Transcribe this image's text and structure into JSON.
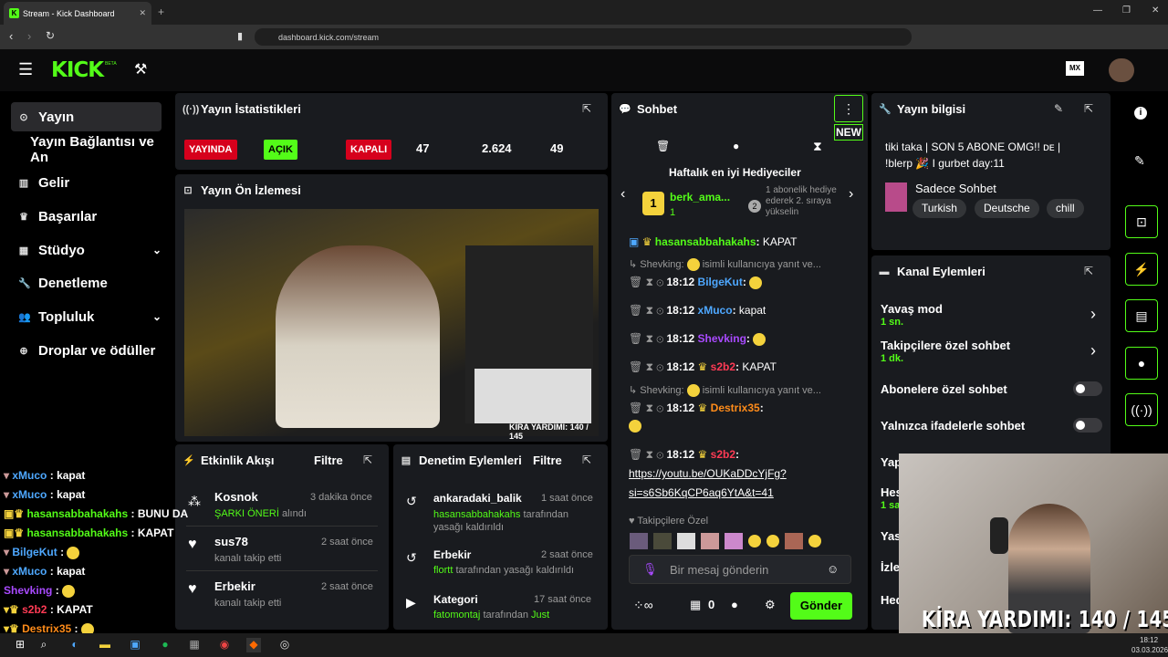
{
  "browser": {
    "tab_title": "Stream - Kick Dashboard",
    "url": "dashboard.kick.com/stream"
  },
  "brand": {
    "logo": "KICK",
    "beta": "BETA"
  },
  "sidebar": {
    "items": [
      {
        "label": "Yayın",
        "icon": "broadcast-icon"
      },
      {
        "label": "Yayın Bağlantısı ve An",
        "icon": ""
      },
      {
        "label": "Gelir",
        "icon": "chart-icon"
      },
      {
        "label": "Başarılar",
        "icon": "trophy-icon"
      },
      {
        "label": "Stüdyo",
        "icon": "studio-icon"
      },
      {
        "label": "Denetleme",
        "icon": "wrench-icon"
      },
      {
        "label": "Topluluk",
        "icon": "people-icon"
      },
      {
        "label": "Droplar ve ödüller",
        "icon": "gift-icon"
      }
    ]
  },
  "stats": {
    "title": "Yayın İstatistikleri",
    "live": "YAYINDA",
    "open": "AÇIK",
    "closed": "KAPALI",
    "v1": "47",
    "v2": "2.624",
    "v3": "49"
  },
  "preview": {
    "title": "Yayın Ön İzlemesi",
    "caption": "KİRA YARDIMI: 140 / 145"
  },
  "activity": {
    "title": "Etkinlik Akışı",
    "filter": "Filtre",
    "items": [
      {
        "name": "Kosnok",
        "time": "3 dakika önce",
        "desc1": "ŞARKI ÖNERİ",
        "desc2": " alındı"
      },
      {
        "name": "sus78",
        "time": "2 saat önce",
        "desc": "kanalı takip etti"
      },
      {
        "name": "Erbekir",
        "time": "2 saat önce",
        "desc": "kanalı takip etti"
      }
    ]
  },
  "moderation": {
    "title": "Denetim Eylemleri",
    "filter": "Filtre",
    "items": [
      {
        "name": "ankaradaki_balik",
        "time": "1 saat önce",
        "by": "hasansabbahakahs",
        "desc": "tarafından yasağı kaldırıldı"
      },
      {
        "name": "Erbekir",
        "time": "2 saat önce",
        "by": "flortt",
        "desc": "tarafından yasağı kaldırıldı"
      },
      {
        "name": "Kategori",
        "time": "17 saat önce",
        "by": "fatomontaj",
        "desc": "tarafından",
        "extra": "Just"
      }
    ]
  },
  "chat": {
    "title": "Sohbet",
    "new": "NEW",
    "top_title": "Haftalık en iyi Hediyeciler",
    "top_user": "berk_ama...",
    "top_count": "1",
    "rank2": "1 abonelik hediye ederek 2. sıraya yükselin",
    "messages": [
      {
        "time": "",
        "user": "hasansabbahakahs",
        "text": "KAPAT",
        "color": "#53fc18"
      },
      {
        "reply": "Shevking:",
        "replytext": "isimli kullanıcıya yanıt ve..."
      },
      {
        "time": "18:12",
        "user": "BilgeKut",
        "text": "",
        "color": "#4ea8ff"
      },
      {
        "time": "18:12",
        "user": "xMuco",
        "text": "kapat",
        "color": "#4ea8ff"
      },
      {
        "time": "18:12",
        "user": "Shevking",
        "text": "",
        "color": "#a94aff"
      },
      {
        "time": "18:12",
        "user": "s2b2",
        "text": "KAPAT",
        "color": "#ff3b55"
      },
      {
        "reply": "Shevking:",
        "replytext": "isimli kullanıcıya yanıt ve..."
      },
      {
        "time": "18:12",
        "user": "Destrix35",
        "text": "",
        "color": "#ff8c1a"
      },
      {
        "time": "18:12",
        "user": "s2b2",
        "text": "",
        "color": "#ff3b55"
      }
    ],
    "link1": "https://youtu.be/OUKaDDcYjFg?",
    "link2": "si=s6Sb6KqCP6aq6YtA&t=41",
    "followers_only": "Takipçilere Özel",
    "placeholder": "Bir mesaj gönderin",
    "count": "0",
    "send": "Gönder"
  },
  "info": {
    "title": "Yayın bilgisi",
    "stream_title": "tiki taka | SON 5 ABONE OMG!! ᴅᴇ | !blerp 🎉 I gurbet day:11",
    "category": "Sadece Sohbet",
    "tags": [
      "Turkish",
      "Deutsche",
      "chill"
    ]
  },
  "actions": {
    "title": "Kanal Eylemleri",
    "items": [
      {
        "label": "Yavaş mod",
        "sub": "1 sn."
      },
      {
        "label": "Takipçilere özel sohbet",
        "sub": "1 dk."
      },
      {
        "label": "Abonelere özel sohbet"
      },
      {
        "label": "Yalnızca ifadelerle sohbet"
      },
      {
        "label": "Yap"
      },
      {
        "label": "Hes",
        "sub": "1 sa"
      },
      {
        "label": "Yas"
      },
      {
        "label": "İzle"
      },
      {
        "label": "Hed"
      }
    ]
  },
  "overlay_chat": [
    {
      "user": "xMuco",
      "text": ": kapat",
      "color": "#4ea8ff"
    },
    {
      "user": "xMuco",
      "text": ": kapat",
      "color": "#4ea8ff"
    },
    {
      "user": "hasansabbahakahs",
      "text": ": BUNU DA",
      "color": "#53fc18"
    },
    {
      "user": "hasansabbahakahs",
      "text": ": KAPAT",
      "color": "#53fc18"
    },
    {
      "user": "BilgeKut",
      "text": ":",
      "color": "#4ea8ff"
    },
    {
      "user": "xMuco",
      "text": ": kapat",
      "color": "#4ea8ff"
    },
    {
      "user": "Shevking",
      "text": ":",
      "color": "#a94aff"
    },
    {
      "user": "s2b2",
      "text": ": KAPAT",
      "color": "#ff3b55"
    },
    {
      "user": "Destrix35",
      "text": ":",
      "color": "#ff8c1a"
    }
  ],
  "webcam_caption": "KİRA YARDIMI:  140 / 145",
  "clock": {
    "time": "18:12",
    "date": "03.03.2026"
  }
}
